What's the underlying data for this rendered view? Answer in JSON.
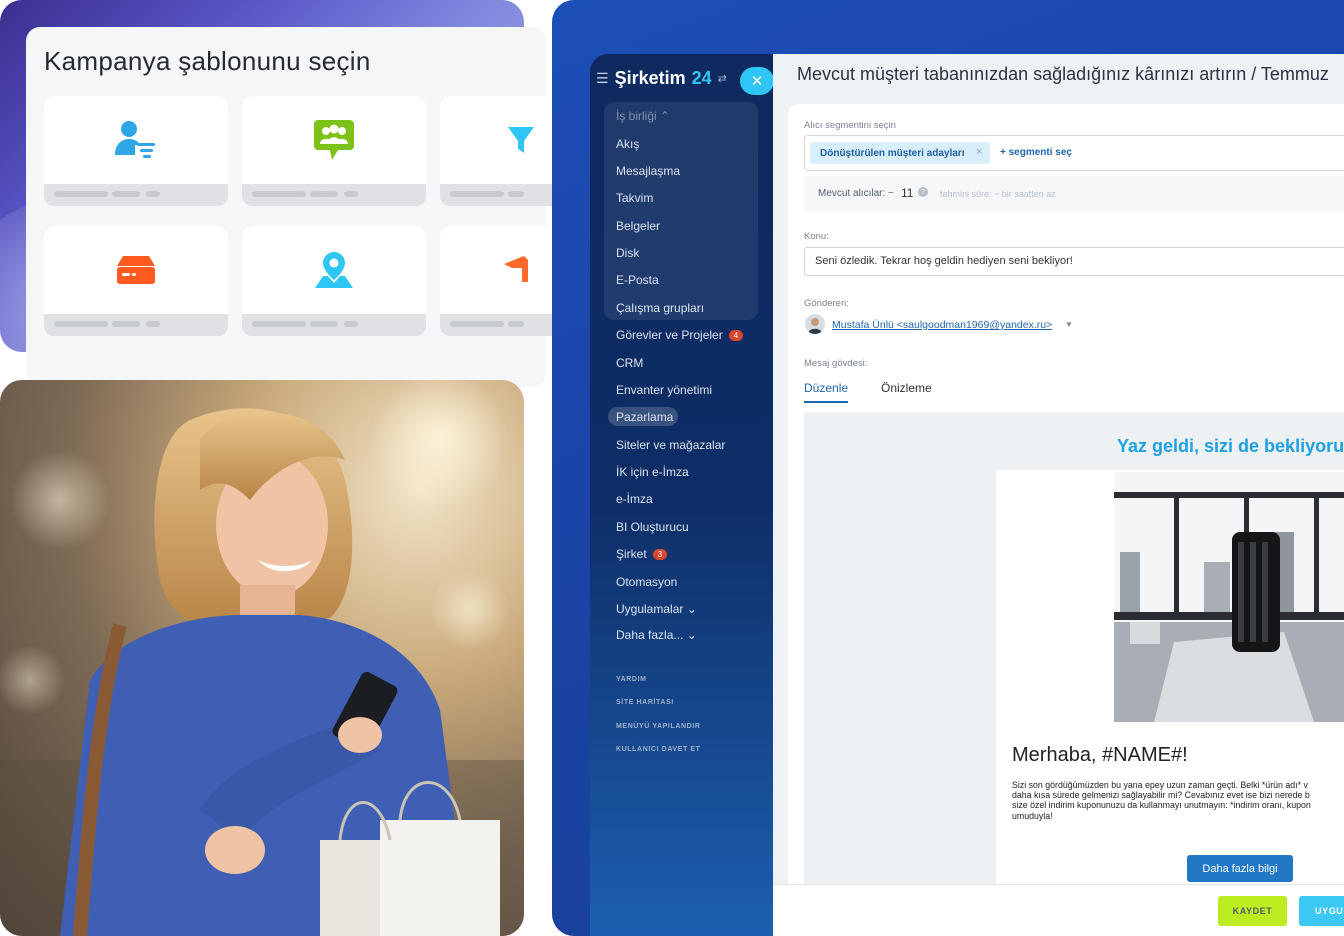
{
  "template_picker": {
    "title": "Kampanya şablonunu seçin",
    "tiles": [
      {
        "icon": "users-filter-icon",
        "color": "#2fa6e8"
      },
      {
        "icon": "chat-group-icon",
        "color": "#7cc218"
      },
      {
        "icon": "funnel-icon",
        "color": "#2fc6f6"
      },
      {
        "icon": "inbox-tray-icon",
        "color": "#ff5a1f"
      },
      {
        "icon": "map-pin-icon",
        "color": "#2fc6f6"
      },
      {
        "icon": "graduation-cap-icon",
        "color": "#ff6a2a"
      }
    ]
  },
  "sidebar": {
    "brand_name": "Şirketim",
    "brand_number": "24",
    "items": [
      {
        "label": "İş birliği ⌃"
      },
      {
        "label": "Akış"
      },
      {
        "label": "Mesajlaşma"
      },
      {
        "label": "Takvim"
      },
      {
        "label": "Belgeler"
      },
      {
        "label": "Disk"
      },
      {
        "label": "E-Posta"
      },
      {
        "label": "Çalışma grupları"
      },
      {
        "label": "Görevler ve Projeler",
        "badge": "4"
      },
      {
        "label": "CRM"
      },
      {
        "label": "Envanter yönetimi"
      },
      {
        "label": "Pazarlama",
        "active": true
      },
      {
        "label": "Siteler ve mağazalar"
      },
      {
        "label": "İK için e-İmza"
      },
      {
        "label": "e-İmza"
      },
      {
        "label": "BI Oluşturucu"
      },
      {
        "label": "Şirket",
        "badge": "3"
      },
      {
        "label": "Otomasyon"
      },
      {
        "label": "Uygulamalar ⌄"
      },
      {
        "label": "Daha fazla... ⌄"
      }
    ],
    "footer_links": [
      "YARDIM",
      "SİTE HARİTASI",
      "MENÜYÜ YAPILANDIR",
      "KULLANICI DAVET ET"
    ]
  },
  "main": {
    "title": "Mevcut müşteri tabanınızdan sağladığınız kârınızı artırın / Temmuz",
    "segment_label": "Alıcı segmentini seçin",
    "segment_chip": "Dönüştürülen müşteri adayları",
    "segment_add": "+ segmenti seç",
    "recipients_label": "Mevcut alıcılar: ~",
    "recipients_count": "11",
    "recipients_hint": "tahmini süre: ~ bir saatten az",
    "subject_label": "Konu:",
    "subject_value": "Seni özledik. Tekrar hoş geldin hediyen seni bekliyor!",
    "sender_label": "Gönderen:",
    "sender_value": "Mustafa Ünlü <saulgoodman1969@yandex.ru>",
    "body_label": "Mesaj gövdesi:",
    "tab_edit": "Düzenle",
    "tab_preview": "Önizleme",
    "email_heading": "Yaz geldi, sizi de bekliyoruz",
    "email_greeting": "Merhaba, #NAME#!",
    "email_body_lines": [
      "Sizi son gördüğümüzden bu yana epey uzun zaman geçti. Belki *ürün adı* v",
      "daha kısa sürede gelmenizi sağlayabilir mi? Cevabınız evet ise bizi nerede b",
      "size özel indirim kuponunuzu da kullanmayı unutmayın: *indirim oranı, kupon",
      "umuduyla!"
    ],
    "email_button": "Daha fazla bilgi",
    "save_button": "KAYDET",
    "apply_button": "UYGULA"
  }
}
